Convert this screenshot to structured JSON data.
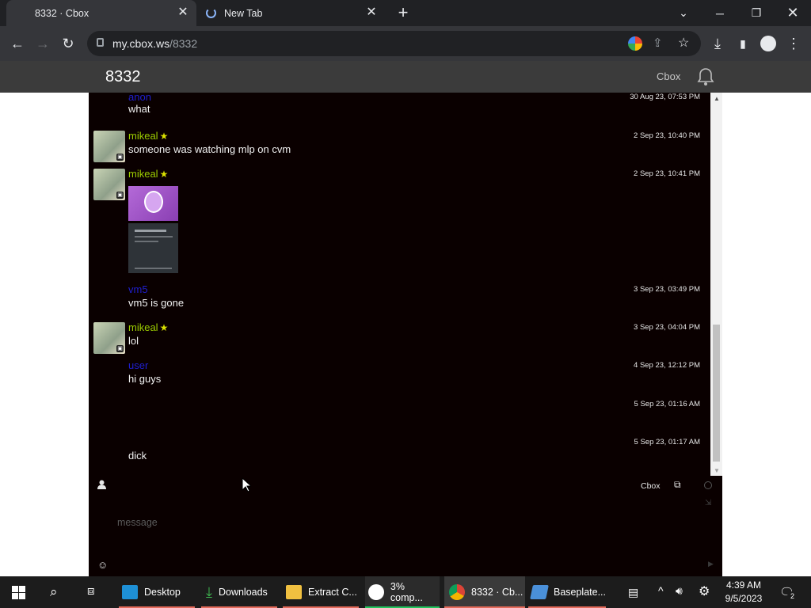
{
  "browser": {
    "tabs": [
      {
        "title": "8332 · Cbox",
        "active": true
      },
      {
        "title": "New Tab",
        "active": false
      }
    ],
    "url_host": "my.cbox.ws",
    "url_path": "/8332"
  },
  "cbox": {
    "title": "8332",
    "brand": "Cbox",
    "messages": [
      {
        "user": "anon",
        "text": "what",
        "time": "30 Aug 23, 07:53 PM",
        "avatar": false
      },
      {
        "user": "mikeal",
        "text": "someone was watching mlp on cvm",
        "time": "2 Sep 23, 10:40 PM",
        "avatar": true
      },
      {
        "user": "mikeal",
        "text": "",
        "time": "2 Sep 23, 10:41 PM",
        "avatar": true,
        "images": [
          "pony-logo-thumbnail",
          "screenshot-thumbnail"
        ]
      },
      {
        "user": "vm5",
        "text": "vm5 is gone",
        "time": "3 Sep 23, 03:49 PM",
        "avatar": false
      },
      {
        "user": "mikeal",
        "text": "lol",
        "time": "3 Sep 23, 04:04 PM",
        "avatar": true
      },
      {
        "user": "user",
        "text": "hi guys",
        "time": "4 Sep 23, 12:12 PM",
        "avatar": false
      },
      {
        "user": "",
        "text": "",
        "time": "5 Sep 23, 01:16 AM",
        "avatar": false
      },
      {
        "user": "",
        "text": "dick",
        "time": "5 Sep 23, 01:17 AM",
        "avatar": false
      }
    ],
    "input": {
      "name_value": "",
      "message_placeholder": "message"
    },
    "footer_brand": "Cbox"
  },
  "taskbar": {
    "items": [
      {
        "label": "Desktop",
        "accent": "#e46a5a"
      },
      {
        "label": "Downloads",
        "accent": "#e46a5a"
      },
      {
        "label": "Extract C...",
        "accent": "#e46a5a"
      },
      {
        "label": "3% comp...",
        "accent": "#22c55e"
      },
      {
        "label": "8332 · Cb...",
        "accent": "#e46a5a"
      },
      {
        "label": "Baseplate...",
        "accent": "#e46a5a"
      }
    ],
    "clock_time": "4:39 AM",
    "clock_date": "9/5/2023",
    "notification_count": "2"
  },
  "colors": {
    "username_member": "#9ccc00",
    "username_guest": "#1f1fd0",
    "chat_background": "#0a0000"
  }
}
